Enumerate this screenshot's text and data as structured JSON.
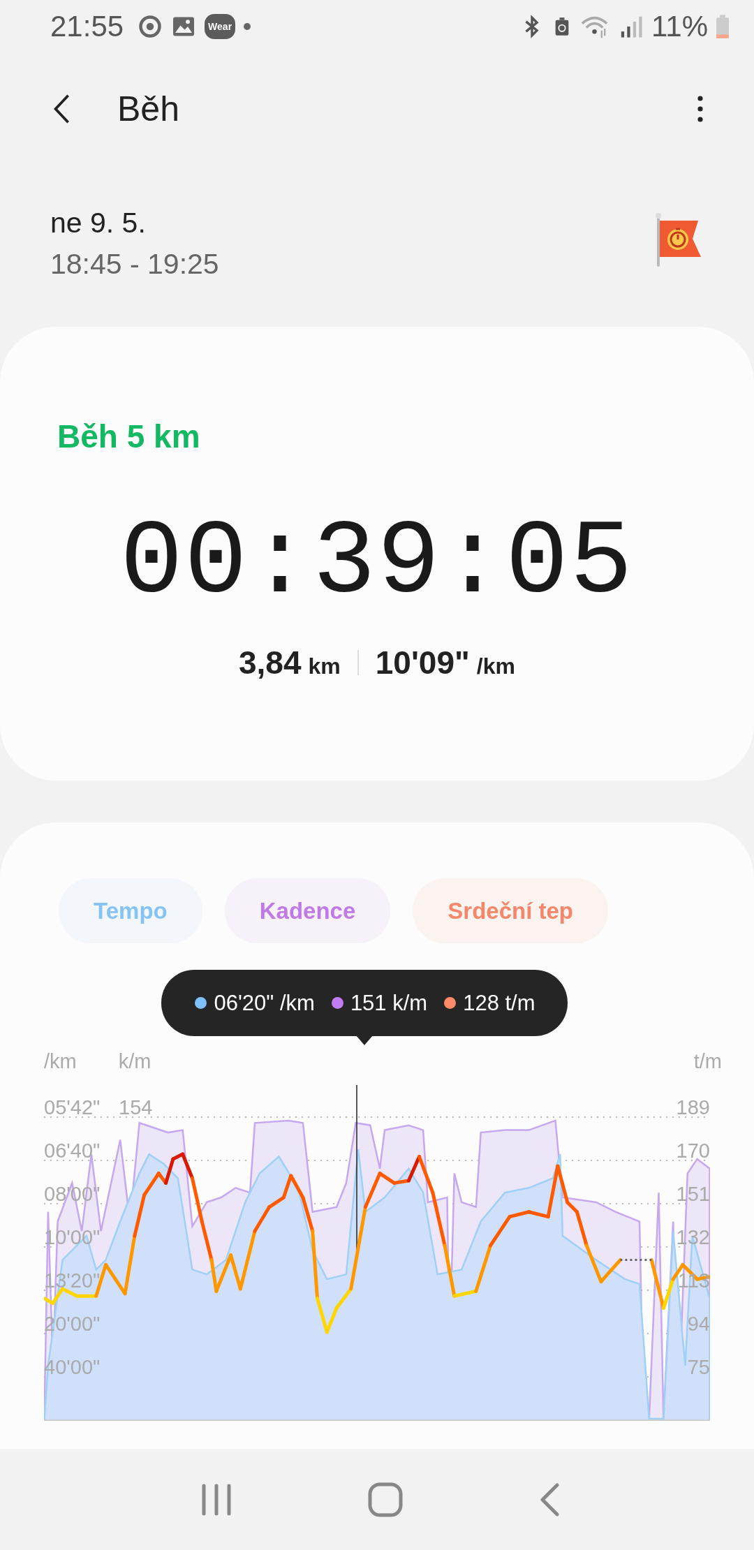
{
  "status_bar": {
    "time": "21:55",
    "wear_badge": "Wear",
    "battery": "11%"
  },
  "header": {
    "title": "Běh"
  },
  "session": {
    "date": "ne 9. 5.",
    "time_range": "18:45 - 19:25"
  },
  "summary": {
    "title": "Běh 5 km",
    "duration": "00:39:05",
    "distance": "3,84",
    "distance_unit": "km",
    "pace": "10'09\"",
    "pace_unit": "/km"
  },
  "chart_panel": {
    "chips": [
      {
        "label": "Tempo",
        "color": "#86c3f5",
        "selected": true
      },
      {
        "label": "Kadence",
        "color": "#c07ae8",
        "selected": true
      },
      {
        "label": "Srdeční tep",
        "color": "#f4866a",
        "selected": true
      }
    ],
    "tooltip": {
      "items": [
        {
          "text": "06'20\" /km",
          "color": "#7fc1fa"
        },
        {
          "text": "151 k/m",
          "color": "#c07cf0"
        },
        {
          "text": "128 t/m",
          "color": "#ff8a6a"
        }
      ]
    },
    "axes": {
      "left_unit": "/km",
      "middle_unit": "k/m",
      "right_unit": "t/m",
      "left_ticks": [
        "05'42\"",
        "06'40\"",
        "08'00\"",
        "10'00\"",
        "13'20\"",
        "20'00\"",
        "40'00\""
      ],
      "middle_ticks": [
        "154"
      ],
      "right_ticks": [
        "189",
        "170",
        "151",
        "132",
        "113",
        "94",
        "75"
      ]
    }
  }
}
